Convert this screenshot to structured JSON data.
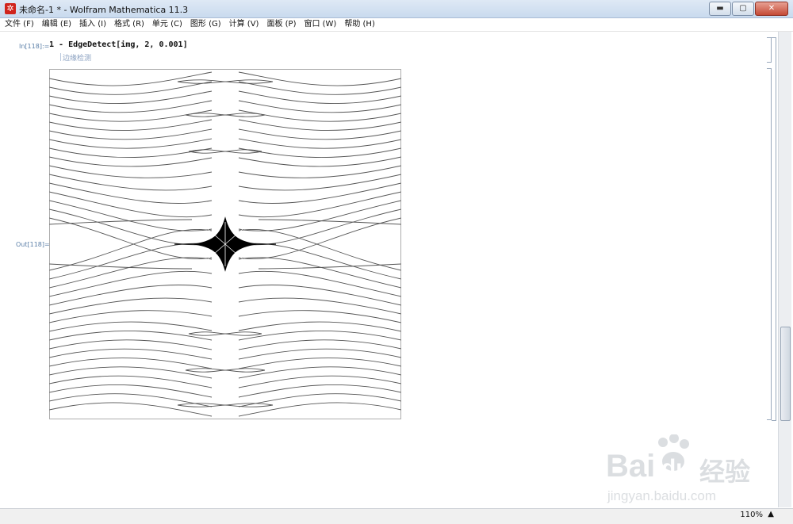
{
  "window": {
    "title": "未命名-1 * - Wolfram Mathematica 11.3",
    "app_icon": "mathematica-icon",
    "controls": {
      "minimize": "▬",
      "maximize": "▢",
      "close": "✕"
    }
  },
  "menu": [
    "文件 (F)",
    "编辑 (E)",
    "插入 (I)",
    "格式 (R)",
    "单元 (C)",
    "图形 (G)",
    "计算 (V)",
    "面板 (P)",
    "窗口 (W)",
    "帮助 (H)"
  ],
  "notebook": {
    "input_label": "In[118]:=",
    "input_code": "1 - EdgeDetect[img, 2, 0.001]",
    "input_hint": "边缘检测",
    "output_label": "Out[118]="
  },
  "status": {
    "zoom": "110%",
    "zoom_arrow": "▲"
  },
  "watermark": {
    "brand": "Bai",
    "brand2": "du",
    "jingyan": "经验",
    "url": "jingyan.baidu.com"
  }
}
